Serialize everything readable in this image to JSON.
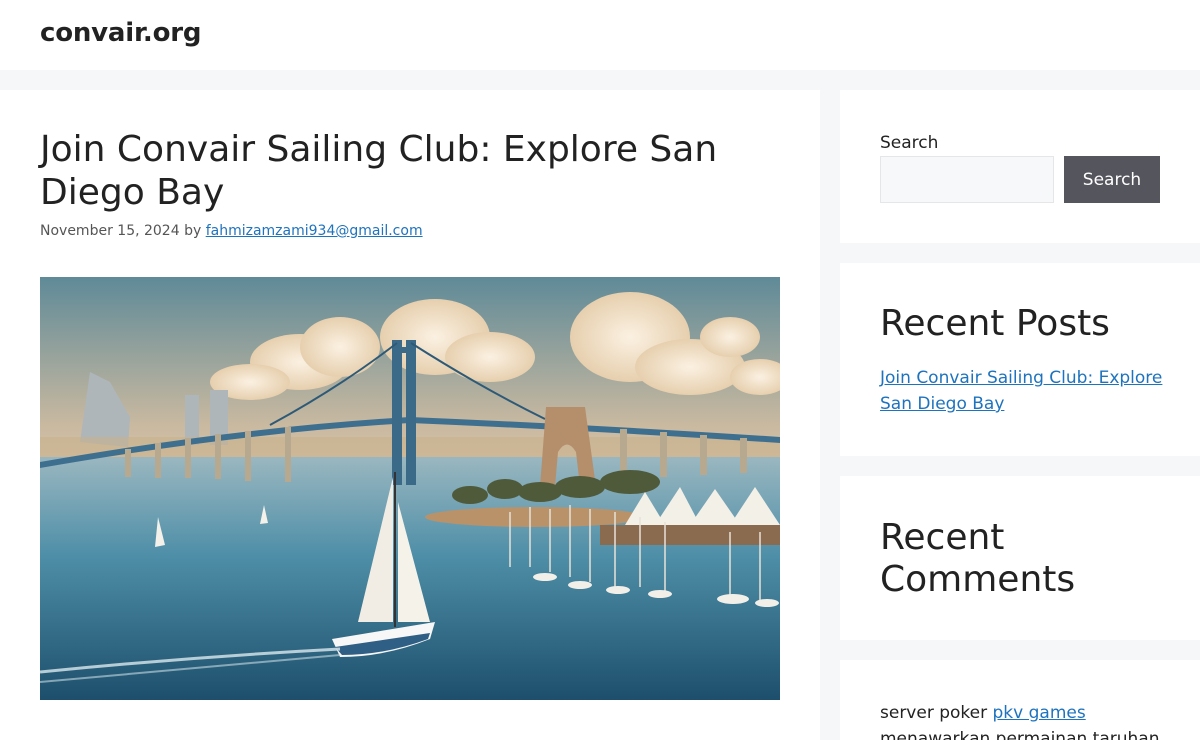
{
  "site": {
    "title": "convair.org"
  },
  "post": {
    "title": "Join Convair Sailing Club: Explore San Diego Bay",
    "date": "November 15, 2024",
    "by": "by",
    "author": "fahmizamzami934@gmail.com"
  },
  "sidebar": {
    "search": {
      "label": "Search",
      "button": "Search",
      "value": ""
    },
    "recent_posts": {
      "title": "Recent Posts",
      "items": [
        "Join Convair Sailing Club: Explore San Diego Bay"
      ]
    },
    "recent_comments": {
      "title": "Recent Comments"
    },
    "text_widget": {
      "prefix": "server poker",
      "link": "pkv games",
      "continuation": "menawarkan permainan taruhan"
    }
  },
  "colors": {
    "link": "#1e73be",
    "button_bg": "#55555e",
    "page_bg": "#f6f7f8"
  }
}
